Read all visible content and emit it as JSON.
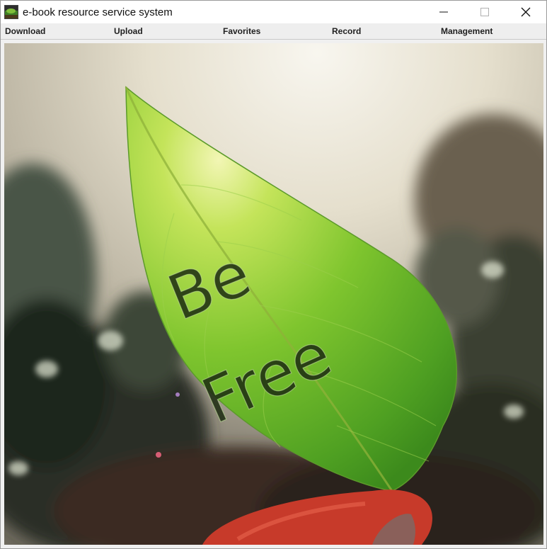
{
  "window": {
    "title": "e-book resource service system",
    "icon": "app-landscape-icon",
    "controls": [
      "minimize-icon",
      "maximize-icon",
      "close-icon"
    ]
  },
  "menu": {
    "items": [
      {
        "label": "Download"
      },
      {
        "label": "Upload"
      },
      {
        "label": "Favorites"
      },
      {
        "label": "Record"
      },
      {
        "label": "Management"
      }
    ]
  },
  "image": {
    "description_icon": "leaf-photo",
    "leaf_text_line1": "Be",
    "leaf_text_line2": "Free"
  },
  "colors": {
    "titlebar": "#ffffff",
    "menubar": "#eeeeee",
    "leaf_green": "#6fbf2a",
    "sky": "#e7e1cf"
  }
}
